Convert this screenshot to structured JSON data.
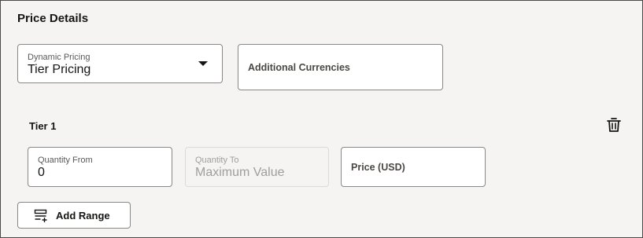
{
  "section": {
    "title": "Price Details"
  },
  "dynamic_pricing": {
    "label": "Dynamic Pricing",
    "value": "Tier Pricing",
    "caret_icon": "caret-down-icon"
  },
  "additional_currencies": {
    "label": "Additional Currencies"
  },
  "tier": {
    "title": "Tier 1",
    "delete_icon": "trash-icon",
    "quantity_from": {
      "label": "Quantity From",
      "value": "0"
    },
    "quantity_to": {
      "label": "Quantity To",
      "value": "Maximum Value"
    },
    "price": {
      "label": "Price (USD)"
    }
  },
  "add_range": {
    "label": "Add Range",
    "icon": "add-range-icon"
  },
  "colors": {
    "background": "#f5f4f2",
    "border": "#8a8884",
    "text": "#161513",
    "disabled_text": "#a09e9b"
  }
}
